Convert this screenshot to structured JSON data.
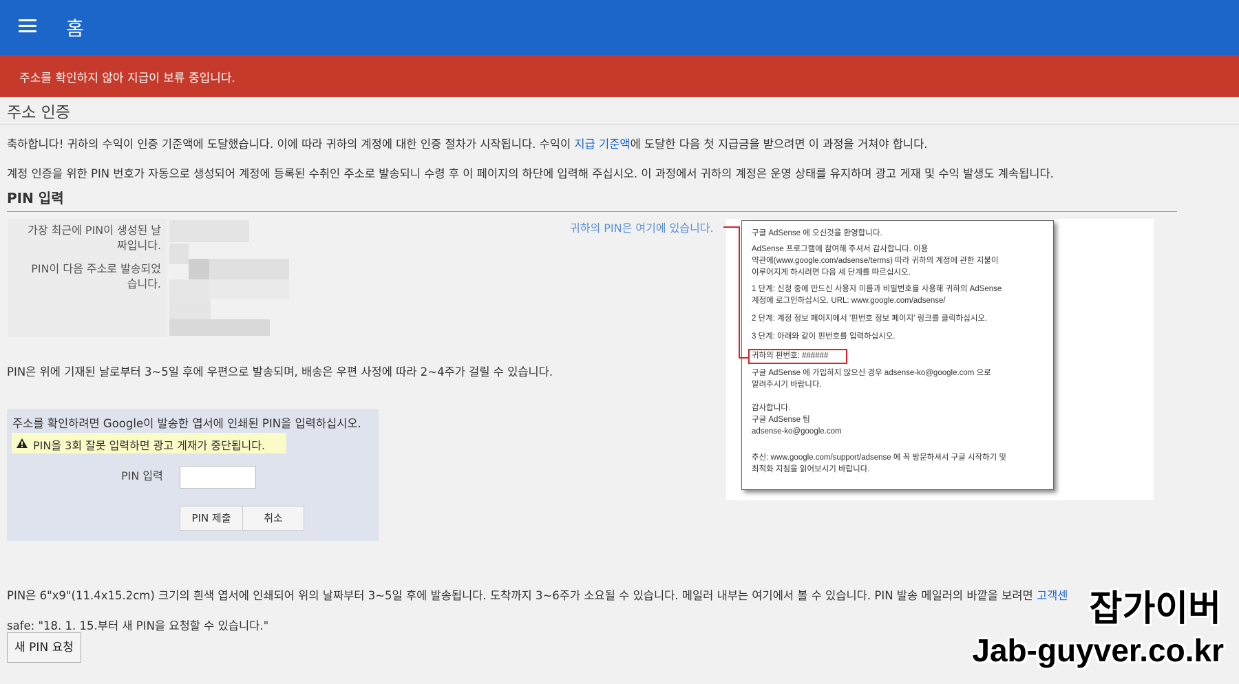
{
  "header": {
    "title": "홈",
    "menu_icon": "hamburger-menu-icon"
  },
  "alert": {
    "text": "주소를 확인하지 않아 지급이 보류 중입니다."
  },
  "page": {
    "title": "주소 인증",
    "para1_before": "축하합니다! 귀하의 수익이 인증 기준액에 도달했습니다. 이에 따라 귀하의 계정에 대한 인증 절차가 시작됩니다. 수익이 ",
    "para1_link": "지급 기준액",
    "para1_after": "에 도달한 다음 첫 지급금을 받으려면 이 과정을 거쳐야 합니다.",
    "para2": "계정 인증을 위한 PIN 번호가 자동으로 생성되어 계정에 등록된 수취인 주소로 발송되니 수령 후 이 페이지의 하단에 입력해 주십시오. 이 과정에서 귀하의 계정은 운영 상태를 유지하며 광고 게재 및 수익 발생도 계속됩니다."
  },
  "pin_section": {
    "title": "PIN 입력",
    "label_date_1": "가장 최근에 PIN이 생성된 날",
    "label_date_2": "짜입니다.",
    "label_address_1": "PIN이 다음 주소로 발송되었",
    "label_address_2": "습니다.",
    "here_text": "귀하의 PIN은 여기에 있습니다.",
    "note": "PIN은 위에 기재된 날로부터 3~5일 후에 우편으로 발송되며, 배송은 우편 사정에 따라 2~4주가 걸릴 수 있습니다."
  },
  "letter": {
    "lines": [
      "구글 AdSense 에  오신것을  환영합니다.",
      "AdSense 프로그램에 참여해 주셔서 감사합니다. 이용",
      "약관에(www.google.com/adsense/terms) 따라 귀하의 계정에 관한 지불이",
      "이루어지게 하시려면 다음 세 단계를 따르십시오.",
      "1 단계: 신청 중에 만드신 사용자 이름과 비밀번호를 사용해 귀하의 AdSense",
      "계정에 로그인하십시오.  URL: www.google.com/adsense/",
      "2 단계: 계정 정보 페이지에서 '핀번호 정보 페이지' 링크를 클릭하십시오.",
      "3 단계: 아래와 같이 핀번호를 입력하십시오.",
      "귀하의 핀번호: ######",
      "구글 AdSense 에 가입하지 않으신 경우 adsense-ko@google.com 으로",
      "알려주시기 바랍니다.",
      "감사합니다.",
      "구글 AdSense 팀",
      "adsense-ko@google.com",
      "추신: www.google.com/support/adsense 에 꼭 방문하셔서 구글 시작하기 및",
      "최적화 지침을 읽어보시기 바랍니다."
    ]
  },
  "form": {
    "instruction": "주소를 확인하려면 Google이 발송한 엽서에 인쇄된 PIN을 입력하십시오.",
    "warning": "PIN을 3회 잘못 입력하면 광고 게재가 중단됩니다.",
    "warning_icon": "warning-triangle-icon",
    "pin_label": "PIN 입력",
    "pin_value": "",
    "submit_label": "PIN 제출",
    "cancel_label": "취소"
  },
  "bottom": {
    "line1_before": "PIN은 6\"x9\"(11.4x15.2cm) 크기의 흰색 엽서에 인쇄되어 위의 날짜부터 3~5일 후에 발송됩니다. 도착까지 3~6주가 소요될 수 있습니다. 메일러 내부는 여기에서 볼 수 있습니다. PIN 발송 메일러의 바깥을 보려면 ",
    "line1_link": "고객센",
    "line2": "safe: \"18. 1. 15.부터 새 PIN을 요청할 수 있습니다.\"",
    "new_pin_button": "새 PIN 요청"
  },
  "watermark": {
    "line1": "잡가이버",
    "line2": "Jab-guyver.co.kr"
  },
  "colors": {
    "topbar": "#1b66c8",
    "alert": "#c53a2b",
    "link": "#1a66cc",
    "warning_bg": "#fbfbc8",
    "form_bg": "#dfe3ed"
  }
}
